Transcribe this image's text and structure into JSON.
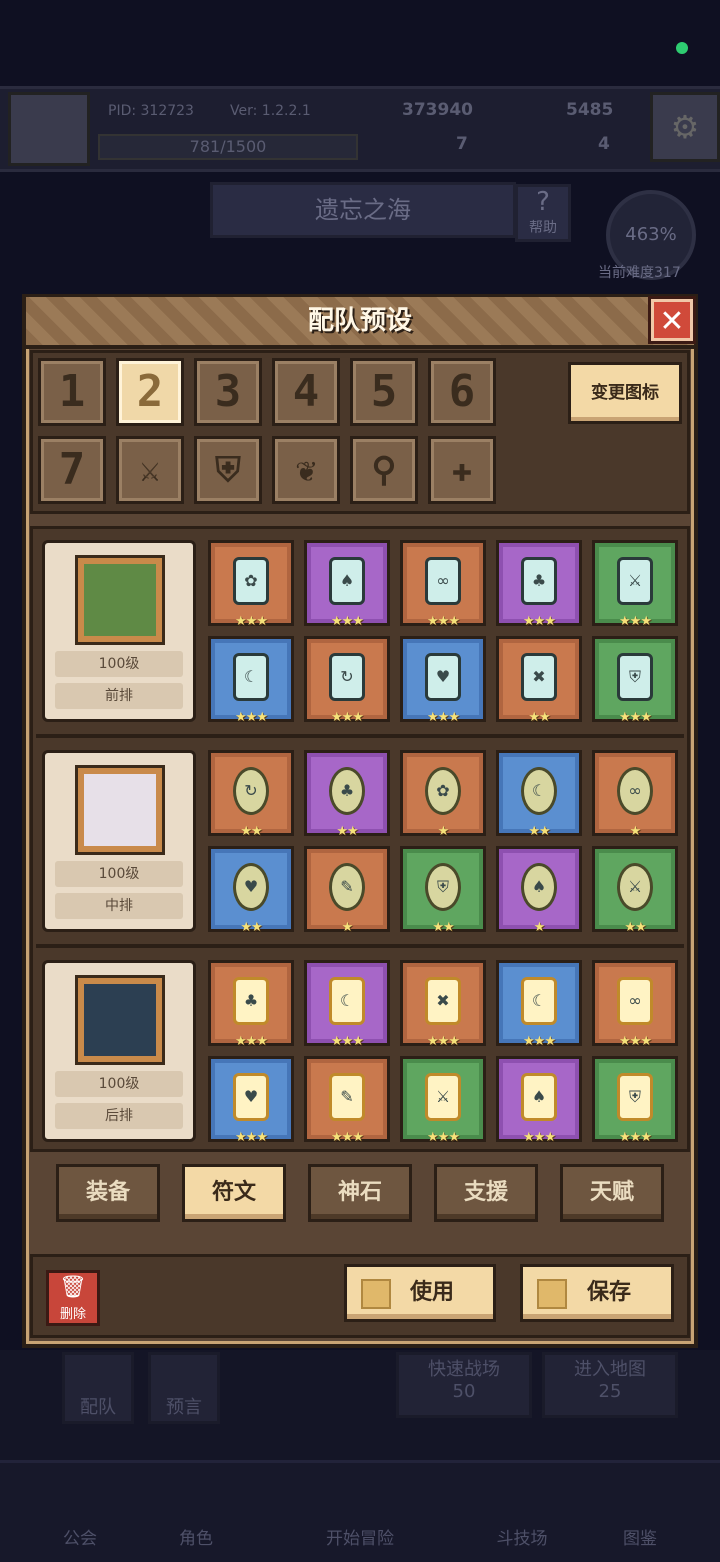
{
  "background": {
    "pid": "PID: 312723",
    "version": "Ver: 1.2.2.1",
    "currency1": "373940",
    "currency2": "5485",
    "exp": "781/1500",
    "stat1": "7",
    "stat2": "4",
    "map_name": "遗忘之海",
    "help_label": "帮助",
    "difficulty_pct": "463%",
    "difficulty_label": "当前难度317",
    "card_team": "配队",
    "card_preset": "预言",
    "quick_battle": "快速战场",
    "quick_battle_cost": "50",
    "enter_map": "进入地图",
    "enter_map_cost": "25",
    "nav": [
      "公会",
      "角色",
      "开始冒险",
      "斗技场",
      "图鉴"
    ]
  },
  "panel": {
    "title": "配队预设",
    "change_icon_label": "变更图标",
    "slots": [
      {
        "label": "1",
        "active": false
      },
      {
        "label": "2",
        "active": true
      },
      {
        "label": "3",
        "active": false
      },
      {
        "label": "4",
        "active": false
      },
      {
        "label": "5",
        "active": false
      },
      {
        "label": "6",
        "active": false
      },
      {
        "label": "7",
        "active": false
      },
      {
        "icon": "sword-icon",
        "glyph": "⚔",
        "active": false
      },
      {
        "icon": "shield-icon",
        "glyph": "⛨",
        "active": false
      },
      {
        "icon": "heart-wings-icon",
        "glyph": "❦",
        "active": false
      },
      {
        "icon": "staff-icon",
        "glyph": "⚲",
        "active": false
      },
      {
        "icon": "cross-icon",
        "glyph": "✚",
        "active": false
      }
    ],
    "heroes": [
      {
        "level": "100级",
        "position": "前排",
        "portrait_color": "#5f8a45"
      },
      {
        "level": "100级",
        "position": "中排",
        "portrait_color": "#e7e0e8"
      },
      {
        "level": "100级",
        "position": "后排",
        "portrait_color": "#2c3f52"
      }
    ],
    "rune_rows": [
      [
        {
          "color": "orange",
          "gem": "teal",
          "glyph": "✿",
          "stars": "★★★"
        },
        {
          "color": "purple",
          "gem": "teal",
          "glyph": "♠",
          "stars": "★★★"
        },
        {
          "color": "orange",
          "gem": "teal",
          "glyph": "∞",
          "stars": "★★★"
        },
        {
          "color": "purple",
          "gem": "teal",
          "glyph": "♣",
          "stars": "★★★"
        },
        {
          "color": "green",
          "gem": "teal",
          "glyph": "⚔",
          "stars": "★★★"
        },
        {
          "color": "blue",
          "gem": "teal",
          "glyph": "☾",
          "stars": "★★★"
        },
        {
          "color": "orange",
          "gem": "teal",
          "glyph": "↻",
          "stars": "★★★"
        },
        {
          "color": "blue",
          "gem": "teal",
          "glyph": "♥",
          "stars": "★★★"
        },
        {
          "color": "orange",
          "gem": "teal",
          "glyph": "✖",
          "stars": "★★"
        },
        {
          "color": "green",
          "gem": "teal",
          "glyph": "⛨",
          "stars": "★★★"
        }
      ],
      [
        {
          "color": "orange",
          "gem": "olive",
          "glyph": "↻",
          "stars": "★★"
        },
        {
          "color": "purple",
          "gem": "olive",
          "glyph": "♣",
          "stars": "★★"
        },
        {
          "color": "orange",
          "gem": "olive",
          "glyph": "✿",
          "stars": "★"
        },
        {
          "color": "blue",
          "gem": "olive",
          "glyph": "☾",
          "stars": "★★"
        },
        {
          "color": "orange",
          "gem": "olive",
          "glyph": "∞",
          "stars": "★"
        },
        {
          "color": "blue",
          "gem": "olive",
          "glyph": "♥",
          "stars": "★★"
        },
        {
          "color": "orange",
          "gem": "olive",
          "glyph": "✎",
          "stars": "★"
        },
        {
          "color": "green",
          "gem": "olive",
          "glyph": "⛨",
          "stars": "★★"
        },
        {
          "color": "purple",
          "gem": "olive",
          "glyph": "♠",
          "stars": "★"
        },
        {
          "color": "green",
          "gem": "olive",
          "glyph": "⚔",
          "stars": "★★"
        }
      ],
      [
        {
          "color": "orange",
          "gem": "gold",
          "glyph": "♣",
          "stars": "★★★"
        },
        {
          "color": "purple",
          "gem": "gold",
          "glyph": "☾",
          "stars": "★★★"
        },
        {
          "color": "orange",
          "gem": "gold",
          "glyph": "✖",
          "stars": "★★★"
        },
        {
          "color": "blue",
          "gem": "gold",
          "glyph": "☾",
          "stars": "★★★"
        },
        {
          "color": "orange",
          "gem": "gold",
          "glyph": "∞",
          "stars": "★★★"
        },
        {
          "color": "blue",
          "gem": "gold",
          "glyph": "♥",
          "stars": "★★★"
        },
        {
          "color": "orange",
          "gem": "gold",
          "glyph": "✎",
          "stars": "★★★"
        },
        {
          "color": "green",
          "gem": "gold",
          "glyph": "⚔",
          "stars": "★★★"
        },
        {
          "color": "purple",
          "gem": "gold",
          "glyph": "♠",
          "stars": "★★★"
        },
        {
          "color": "green",
          "gem": "gold",
          "glyph": "⛨",
          "stars": "★★★"
        }
      ]
    ],
    "tabs": [
      {
        "label": "装备",
        "active": false
      },
      {
        "label": "符文",
        "active": true
      },
      {
        "label": "神石",
        "active": false
      },
      {
        "label": "支援",
        "active": false
      },
      {
        "label": "天赋",
        "active": false
      }
    ],
    "delete_label": "删除",
    "use_label": "使用",
    "save_label": "保存"
  }
}
